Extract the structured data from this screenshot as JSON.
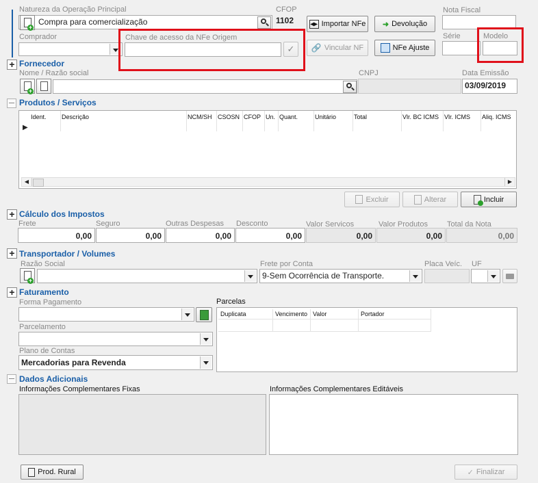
{
  "operation": {
    "natureza_label": "Natureza da Operação Principal",
    "natureza_value": "Compra para comercialização",
    "cfop_label": "CFOP",
    "cfop_value": "1102",
    "import_nfe_label": "Importar NFe",
    "devolucao_label": "Devolução",
    "nota_fiscal_label": "Nota Fiscal",
    "nota_fiscal_value": "",
    "comprador_label": "Comprador",
    "comprador_value": "",
    "chave_label": "Chave de acesso da NFe Origem",
    "chave_value": "",
    "vincular_label": "Vincular NF",
    "nfe_ajuste_label": "NFe Ajuste",
    "serie_label": "Série",
    "serie_value": "",
    "modelo_label": "Modelo",
    "modelo_value": ""
  },
  "fornecedor": {
    "title": "Fornecedor",
    "nome_label": "Nome / Razão social",
    "nome_value": "",
    "cnpj_label": "CNPJ",
    "cnpj_value": "",
    "data_label": "Data Emissão",
    "data_value": "03/09/2019"
  },
  "produtos": {
    "title": "Produtos / Serviços",
    "columns": [
      "Ident.",
      "Descrição",
      "NCM/SH",
      "CSOSN",
      "CFOP",
      "Un.",
      "Quant.",
      "Unitário",
      "Total",
      "Vlr. BC ICMS",
      "Vlr. ICMS",
      "Aliq. ICMS"
    ],
    "excluir_label": "Excluir",
    "alterar_label": "Alterar",
    "incluir_label": "Incluir"
  },
  "impostos": {
    "title": "Cálculo dos Impostos",
    "fields": [
      {
        "label": "Frete",
        "value": "0,00"
      },
      {
        "label": "Seguro",
        "value": "0,00"
      },
      {
        "label": "Outras Despesas",
        "value": "0,00"
      },
      {
        "label": "Desconto",
        "value": "0,00"
      },
      {
        "label": "Valor Servicos",
        "value": "0,00"
      },
      {
        "label": "Valor Produtos",
        "value": "0,00"
      },
      {
        "label": "Total da Nota",
        "value": "0,00"
      }
    ]
  },
  "transportador": {
    "title": "Transportador / Volumes",
    "razao_label": "Razão Social",
    "razao_value": "",
    "frete_label": "Frete por Conta",
    "frete_value": "9-Sem Ocorrência de Transporte.",
    "placa_label": "Placa Veíc.",
    "placa_value": "",
    "uf_label": "UF",
    "uf_value": ""
  },
  "faturamento": {
    "title": "Faturamento",
    "forma_label": "Forma Pagamento",
    "forma_value": "",
    "parcelamento_label": "Parcelamento",
    "parcelamento_value": "",
    "plano_label": "Plano de Contas",
    "plano_value": "Mercadorias para Revenda",
    "parcelas_label": "Parcelas",
    "parcelas_columns": [
      "Duplicata",
      "Vencimento",
      "Valor",
      "Portador"
    ]
  },
  "adicionais": {
    "title": "Dados Adicionais",
    "fixas_label": "Informações Complementares Fixas",
    "editaveis_label": "Informações Complementares Editáveis"
  },
  "footer": {
    "prod_rural_label": "Prod. Rural",
    "finalizar_label": "Finalizar"
  }
}
